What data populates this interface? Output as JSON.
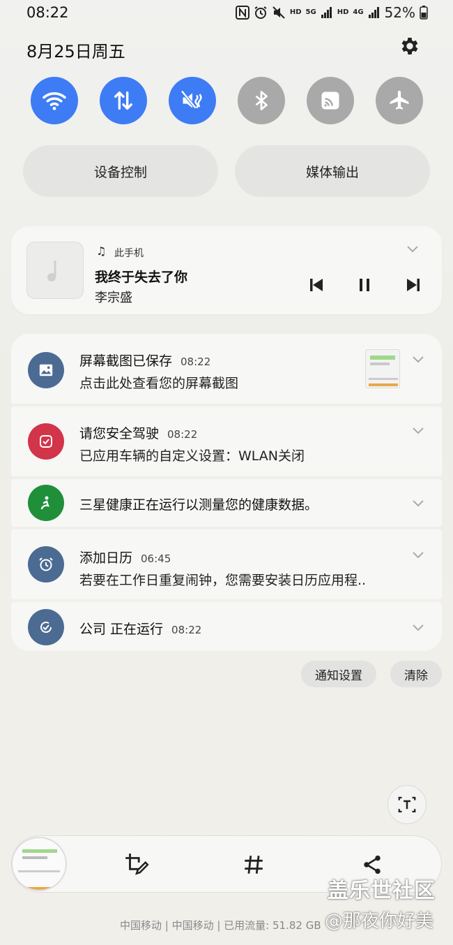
{
  "status_bar": {
    "time": "08:22",
    "icons": [
      "nfc-icon",
      "alarm-icon",
      "mute-icon",
      "hd-icon",
      "5g-icon",
      "signal-icon",
      "hd-icon",
      "4g-icon",
      "signal-icon",
      "battery-icon"
    ],
    "hd_label": "HD",
    "net1_label": "5G",
    "net2_label": "4G",
    "battery": "52%"
  },
  "header": {
    "date": "8月25日周五"
  },
  "quick_settings": {
    "toggles": [
      {
        "name": "wifi",
        "active": true
      },
      {
        "name": "mobile-data",
        "active": true
      },
      {
        "name": "sound-mute",
        "active": true
      },
      {
        "name": "bluetooth",
        "active": false
      },
      {
        "name": "nfc-cast",
        "active": false
      },
      {
        "name": "airplane-mode",
        "active": false
      }
    ],
    "device_control": "设备控制",
    "media_output": "媒体输出"
  },
  "media": {
    "source": "此手机",
    "title": "我终于失去了你",
    "artist": "李宗盛"
  },
  "notifications": [
    {
      "title": "屏幕截图已保存",
      "time": "08:22",
      "body": "点击此处查看您的屏幕截图",
      "icon": "image-icon",
      "color": "#4b6b93"
    },
    {
      "title": "请您安全驾驶",
      "time": "08:22",
      "body": "已应用车辆的自定义设置：WLAN关闭",
      "icon": "car-mode-icon",
      "color": "#d2344a"
    },
    {
      "title": "三星健康正在运行以测量您的健康数据。",
      "time": "",
      "body": "",
      "icon": "health-icon",
      "color": "#1f8f3a"
    },
    {
      "title": "添加日历",
      "time": "06:45",
      "body": "若要在工作日重复闹钟，您需要安装日历应用程..",
      "icon": "alarm-clock-icon",
      "color": "#4b6b93"
    },
    {
      "title": "公司 正在运行",
      "time": "08:22",
      "body": "",
      "icon": "routine-icon",
      "color": "#4b6b93"
    }
  ],
  "actions": {
    "notification_settings": "通知设置",
    "clear": "清除"
  },
  "footer": {
    "carrier": "中国移动 | 中国移动 | 已用流量: 51.82 GB",
    "watermark_site": "盖乐世社区",
    "watermark_user": "@那夜你好美"
  },
  "colors": {
    "accent": "#3d7cf5",
    "inactive": "#a9a9a9"
  }
}
